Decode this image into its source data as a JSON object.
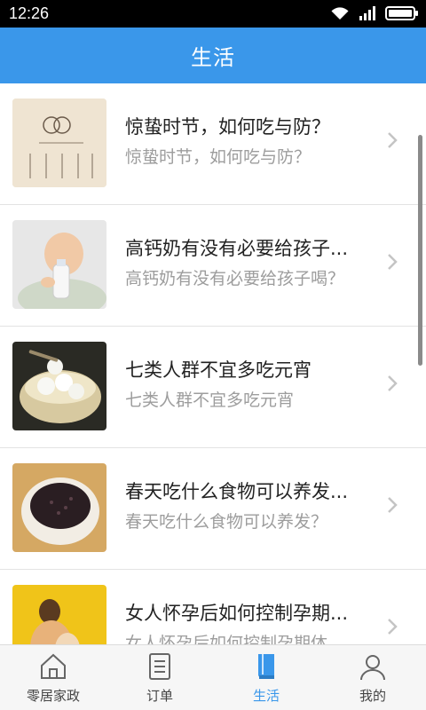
{
  "status": {
    "time": "12:26"
  },
  "header": {
    "title": "生活"
  },
  "articles": [
    {
      "title": "惊蛰时节，如何吃与防？",
      "subtitle": "惊蛰时节，如何吃与防？",
      "thumb": "jingzhe-chart"
    },
    {
      "title": "高钙奶有没有必要给孩子...",
      "subtitle": "高钙奶有没有必要给孩子喝？",
      "thumb": "baby-milk"
    },
    {
      "title": "七类人群不宜多吃元宵",
      "subtitle": "七类人群不宜多吃元宵",
      "thumb": "yuanxiao-bowl"
    },
    {
      "title": "春天吃什么食物可以养发...",
      "subtitle": "春天吃什么食物可以养发？",
      "thumb": "black-rice-bowl"
    },
    {
      "title": "女人怀孕后如何控制孕期...",
      "subtitle": "女人怀孕后如何控制孕期体",
      "thumb": "pregnant-woman"
    }
  ],
  "nav": {
    "items": [
      {
        "label": "零居家政",
        "icon": "home-icon"
      },
      {
        "label": "订单",
        "icon": "order-icon"
      },
      {
        "label": "生活",
        "icon": "book-icon",
        "active": true
      },
      {
        "label": "我的",
        "icon": "user-icon"
      }
    ]
  },
  "colors": {
    "accent": "#3a97ea",
    "text": "#222222",
    "subtext": "#9d9d9d"
  }
}
